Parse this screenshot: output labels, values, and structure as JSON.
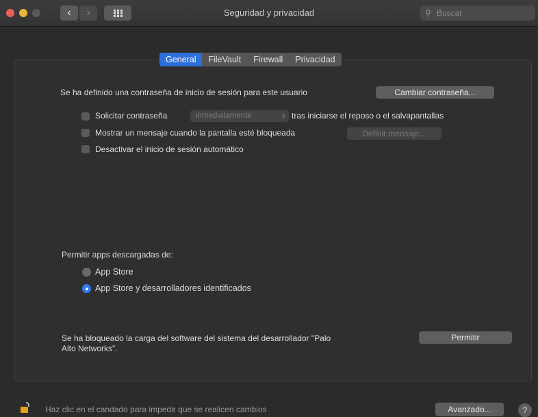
{
  "window": {
    "title": "Seguridad y privacidad"
  },
  "toolbar": {
    "back_icon": "chevron-left-icon",
    "forward_icon": "chevron-right-icon",
    "grid_icon": "grid-icon"
  },
  "search": {
    "placeholder": "Buscar",
    "icon": "search-icon"
  },
  "tabs": [
    {
      "label": "General",
      "selected": true
    },
    {
      "label": "FileVault",
      "selected": false
    },
    {
      "label": "Firewall",
      "selected": false
    },
    {
      "label": "Privacidad",
      "selected": false
    }
  ],
  "general": {
    "password_text": "Se ha definido una contraseña de inicio de sesión para este usuario",
    "change_password_label": "Cambiar contraseña...",
    "require_password_label": "Solicitar contraseña",
    "require_password_value": "inmediatamente",
    "require_password_suffix": "tras iniciarse el reposo o el salvapantallas",
    "show_message_label": "Mostrar un mensaje cuando la pantalla esté bloqueada",
    "set_message_label": "Definir mensaje...",
    "disable_autologin_label": "Desactivar el inicio de sesión automático",
    "allow_apps_label": "Permitir apps descargadas de:",
    "radio_app_store": "App Store",
    "radio_app_store_identified": "App Store y desarrolladores identificados",
    "blocked_line1": "Se ha bloqueado la carga del software del sistema del desarrollador \"Palo",
    "blocked_line2": "Alto Networks\".",
    "allow_button_label": "Permitir"
  },
  "footer": {
    "lock_text": "Haz clic en el candado para impedir que se realicen cambios",
    "advanced_label": "Avanzado...",
    "help_label": "?"
  },
  "colors": {
    "accent": "#2e6fd8",
    "lock": "#e8a21a"
  }
}
